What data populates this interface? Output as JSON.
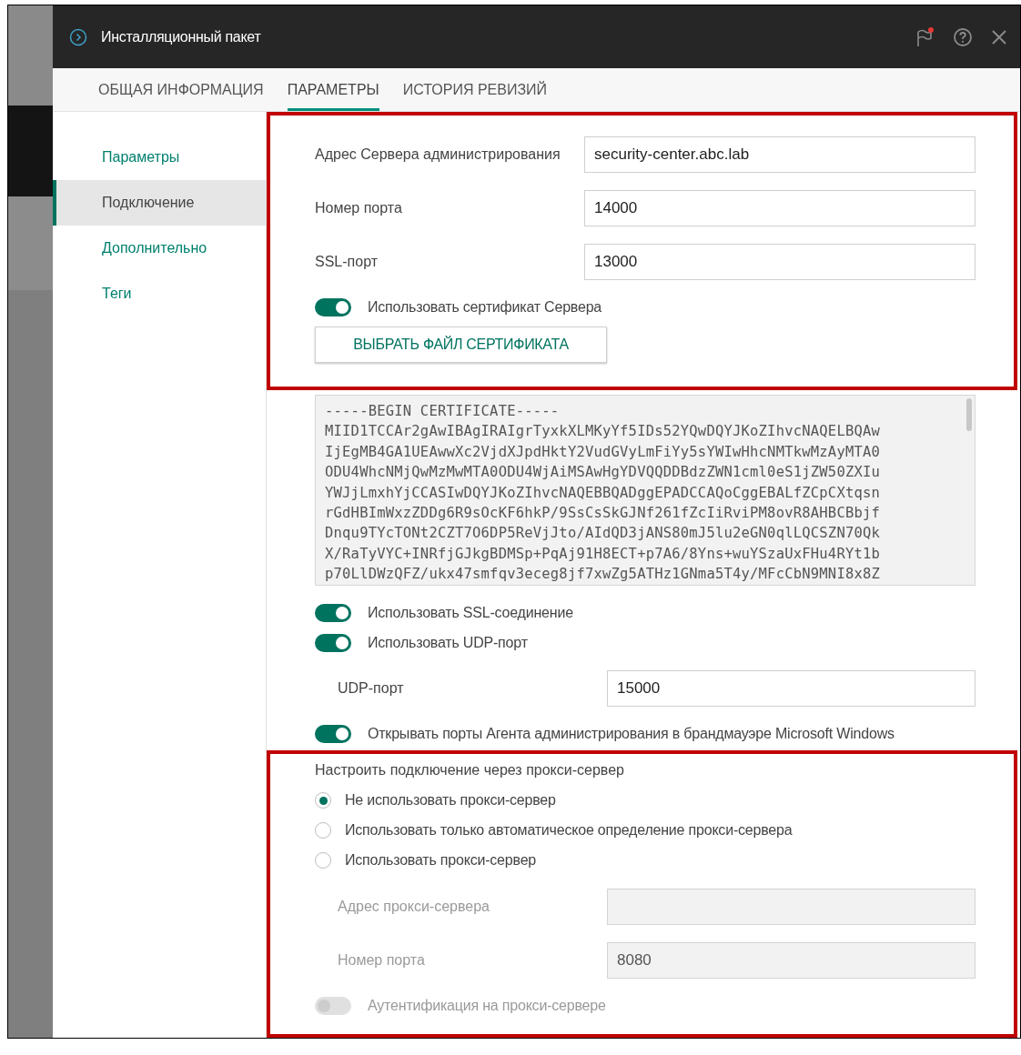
{
  "window": {
    "title": "Инсталляционный пакет"
  },
  "tabs": [
    {
      "label": "ОБЩАЯ ИНФОРМАЦИЯ",
      "selected": false
    },
    {
      "label": "ПАРАМЕТРЫ",
      "selected": true
    },
    {
      "label": "ИСТОРИЯ РЕВИЗИЙ",
      "selected": false
    }
  ],
  "sidebar": {
    "items": [
      {
        "label": "Параметры",
        "selected": false
      },
      {
        "label": "Подключение",
        "selected": true
      },
      {
        "label": "Дополнительно",
        "selected": false
      },
      {
        "label": "Теги",
        "selected": false
      }
    ]
  },
  "sections": [
    {
      "highlighted": true,
      "items": [
        {
          "kind": "field",
          "label": "Адрес Сервера администрирования",
          "value": "security-center.abc.lab",
          "disabled": false,
          "indented": false
        },
        {
          "kind": "field",
          "label": "Номер порта",
          "value": "14000",
          "disabled": false,
          "indented": false
        },
        {
          "kind": "field",
          "label": "SSL-порт",
          "value": "13000",
          "disabled": false,
          "indented": false
        },
        {
          "kind": "toggle",
          "label": "Использовать сертификат Сервера",
          "on": true,
          "disabled": false
        },
        {
          "kind": "button",
          "label": "ВЫБРАТЬ ФАЙЛ СЕРТИФИКАТА"
        }
      ]
    },
    {
      "highlighted": false,
      "items": [
        {
          "kind": "certificate",
          "lines": [
            "-----BEGIN CERTIFICATE-----",
            "MIID1TCCAr2gAwIBAgIRAIgrTyxkXLMKyYf5IDs52YQwDQYJKoZIhvcNAQELBQAw",
            "IjEgMB4GA1UEAwwXc2VjdXJpdHktY2VudGVyLmFiYy5sYWIwHhcNMTkwMzAyMTA0",
            "ODU4WhcNMjQwMzMwMTA0ODU4WjAiMSAwHgYDVQQDDBdzZWN1cml0eS1jZW50ZXIu",
            "YWJjLmxhYjCCASIwDQYJKoZIhvcNAQEBBQADggEPADCCAQoCggEBALfZCpCXtqsn",
            "rGdHBImWxzZDDg6R9sOcKF6hkP/9SsCsSkGJNf261fZcIiRviPM8ovR8AHBCBbjf",
            "Dnqu9TYcTONt2CZT7O6DP5ReVjJto/AIdQD3jANS80mJ5lu2eGN0qlLQCSZN70Qk",
            "X/RaTyVYC+INRfjGJkgBDMSp+PqAj91H8ECT+p7A6/8Yns+wuYSzaUxFHu4RYt1b",
            "p70LlDWzQFZ/ukx47smfqv3eceg8jf7xwZg5ATHz1GNma5T4y/MFcCbN9MNI8x8Z"
          ]
        },
        {
          "kind": "toggle",
          "label": "Использовать SSL-соединение",
          "on": true,
          "disabled": false
        },
        {
          "kind": "toggle",
          "label": "Использовать UDP-порт",
          "on": true,
          "disabled": false
        },
        {
          "kind": "field",
          "label": "UDP-порт",
          "value": "15000",
          "disabled": false,
          "indented": true
        },
        {
          "kind": "toggle",
          "label": "Открывать порты Агента администрирования в брандмауэре Microsoft Windows",
          "on": true,
          "disabled": false
        }
      ]
    },
    {
      "highlighted": true,
      "items": [
        {
          "kind": "heading",
          "label": "Настроить подключение через прокси-сервер"
        },
        {
          "kind": "radio",
          "label": "Не использовать прокси-сервер",
          "selected": true
        },
        {
          "kind": "radio",
          "label": "Использовать только автоматическое определение прокси-сервера",
          "selected": false
        },
        {
          "kind": "radio",
          "label": "Использовать прокси-сервер",
          "selected": false
        },
        {
          "kind": "field",
          "label": "Адрес прокси-сервера",
          "disabled": true,
          "indented": true
        },
        {
          "kind": "field",
          "label": "Номер порта",
          "value": "8080",
          "disabled": true,
          "indented": true
        },
        {
          "kind": "toggle",
          "label": "Аутентификация на прокси-сервере",
          "on": false,
          "disabled": true
        }
      ]
    }
  ]
}
